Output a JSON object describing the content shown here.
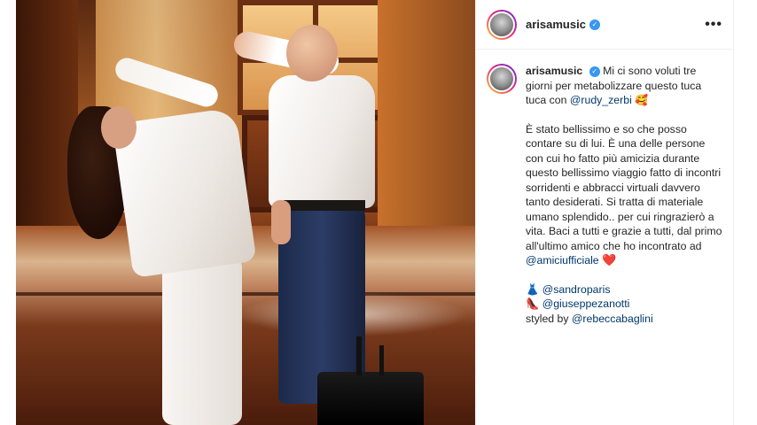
{
  "post": {
    "username": "arisamusic",
    "more_label": "•••",
    "verified_mark": "✓"
  },
  "caption": {
    "username": "arisamusic",
    "line1_pre": " Mi ci sono voluti tre giorni per metabolizzare questo tuca tuca con ",
    "mention_rudy": "@rudy_zerbi",
    "emoji_1": "🥰",
    "para2_pre": "È stato bellissimo e so che posso contare su di lui. È una delle persone con cui ho fatto più amicizia durante questo bellissimo viaggio fatto di incontri sorridenti e abbracci virtuali davvero tanto desiderati. Si tratta di materiale umano splendido.. per cui ringrazierò a vita. Baci a tutti e grazie a tutti, dal primo all'ultimo amico che ho incontrato ad ",
    "mention_amici": "@amiciufficiale",
    "heart": "❤️",
    "dress_emoji": "👗",
    "mention_sandro": "@sandroparis",
    "heel_emoji": "👠",
    "mention_giuseppe": "@giuseppezanotti",
    "styled_by": "styled by ",
    "mention_rebecca": "@rebeccabaglini"
  },
  "colors": {
    "verified": "#3897f0",
    "mention": "#00376b",
    "text": "#262626",
    "border": "#efefef"
  },
  "icons": {
    "verified": "verified-badge-icon",
    "more": "more-options-icon"
  }
}
